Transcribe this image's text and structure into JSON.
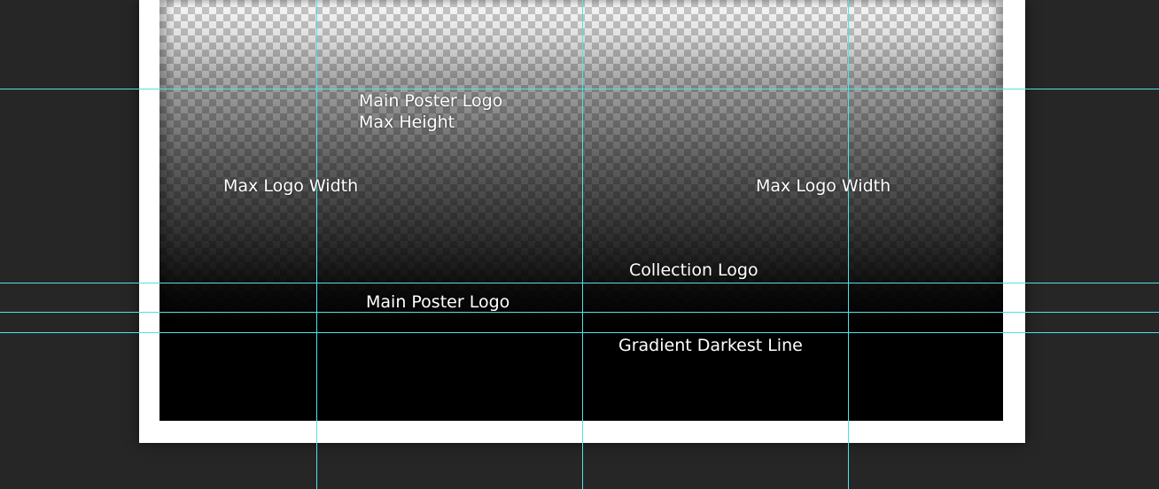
{
  "workspace": {
    "background_color": "#262626",
    "guide_color": "#4fe3e3"
  },
  "canvas": {
    "border_color": "#ffffff",
    "gradient_end_color": "#000000"
  },
  "labels": {
    "main_poster_logo_max_height_line1": "Main Poster Logo",
    "main_poster_logo_max_height_line2": "Max Height",
    "max_logo_width_left": "Max Logo Width",
    "max_logo_width_right": "Max Logo Width",
    "collection_logo": "Collection Logo",
    "main_poster_logo": "Main Poster Logo",
    "gradient_darkest_line": "Gradient Darkest Line"
  }
}
